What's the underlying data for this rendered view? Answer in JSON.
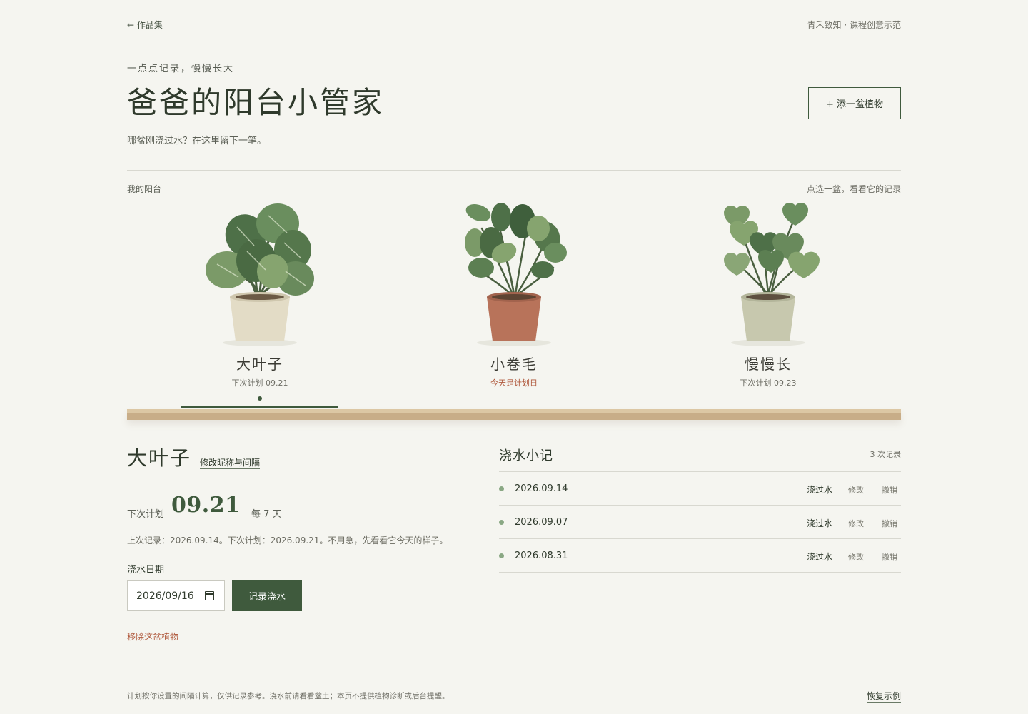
{
  "topbar": {
    "back_label": "← 作品集",
    "credit": "青禾致知 · 课程创意示范"
  },
  "hero": {
    "eyebrow": "一点点记录，慢慢长大",
    "title": "爸爸的阳台小管家",
    "subtitle": "哪盆刚浇过水？在这里留下一笔。",
    "add_button": "+  添一盆植物"
  },
  "balcony": {
    "label": "我的阳台",
    "hint": "点选一盆，看看它的记录",
    "plants": [
      {
        "name": "大叶子",
        "next": "下次计划 09.21",
        "selected": true,
        "pot_color": "#e3dcc6",
        "icon": "round-leaf-plant-icon"
      },
      {
        "name": "小卷毛",
        "next": "今天是计划日",
        "selected": false,
        "pot_color": "#b8735a",
        "icon": "curly-leaf-plant-icon"
      },
      {
        "name": "慢慢长",
        "next": "下次计划 09.23",
        "selected": false,
        "pot_color": "#c7c8ae",
        "icon": "heart-leaf-plant-icon"
      }
    ]
  },
  "detail": {
    "name": "大叶子",
    "edit_link": "修改昵称与间隔",
    "next_label": "下次计划",
    "next_date": "09.21",
    "interval": "每 7 天",
    "status": "上次记录：2026.09.14。下次计划：2026.09.21。不用急，先看看它今天的样子。",
    "date_label": "浇水日期",
    "date_value": "2026/09/16",
    "record_button": "记录浇水",
    "remove_link": "移除这盆植物"
  },
  "log": {
    "title": "浇水小记",
    "count": "3 次记录",
    "entries": [
      {
        "date": "2026.09.14",
        "type": "浇过水",
        "edit": "修改",
        "undo": "撤销"
      },
      {
        "date": "2026.09.07",
        "type": "浇过水",
        "edit": "修改",
        "undo": "撤销"
      },
      {
        "date": "2026.08.31",
        "type": "浇过水",
        "edit": "修改",
        "undo": "撤销"
      }
    ]
  },
  "footer": {
    "note": "计划按你设置的间隔计算，仅供记录参考。浇水前请看看盆土；本页不提供植物诊断或后台提醒。",
    "restore_link": "恢复示例"
  },
  "colors": {
    "accent": "#3f5a3d",
    "warning": "#b0593d",
    "shelf": "#c8ad88",
    "background": "#f5f5f0"
  }
}
